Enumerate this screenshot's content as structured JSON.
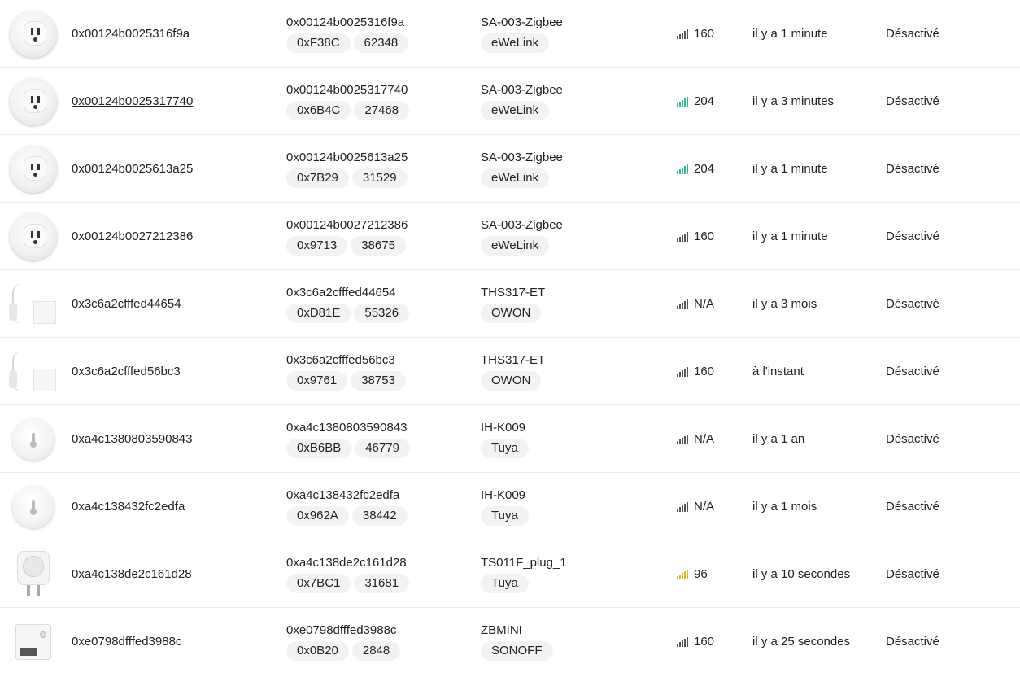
{
  "colors": {
    "signal_default": "#555555",
    "signal_good": "#2fbf8f",
    "signal_medium": "#e8b820"
  },
  "devices": [
    {
      "thumb": "round-plug-icon",
      "ieee": "0x00124b0025316f9a",
      "ieee_link": false,
      "ieee2": "0x00124b0025316f9a",
      "nwk": "0xF38C",
      "nwk_dec": "62348",
      "model": "SA-003-Zigbee",
      "vendor": "eWeLink",
      "lqi": "160",
      "signal_color": "#555555",
      "last_seen": "il y a 1 minute",
      "status": "Désactivé"
    },
    {
      "thumb": "round-plug-icon",
      "ieee": "0x00124b0025317740",
      "ieee_link": true,
      "ieee2": "0x00124b0025317740",
      "nwk": "0x6B4C",
      "nwk_dec": "27468",
      "model": "SA-003-Zigbee",
      "vendor": "eWeLink",
      "lqi": "204",
      "signal_color": "#2fbf8f",
      "last_seen": "il y a 3 minutes",
      "status": "Désactivé"
    },
    {
      "thumb": "round-plug-icon",
      "ieee": "0x00124b0025613a25",
      "ieee_link": false,
      "ieee2": "0x00124b0025613a25",
      "nwk": "0x7B29",
      "nwk_dec": "31529",
      "model": "SA-003-Zigbee",
      "vendor": "eWeLink",
      "lqi": "204",
      "signal_color": "#2fbf8f",
      "last_seen": "il y a 1 minute",
      "status": "Désactivé"
    },
    {
      "thumb": "round-plug-icon",
      "ieee": "0x00124b0027212386",
      "ieee_link": false,
      "ieee2": "0x00124b0027212386",
      "nwk": "0x9713",
      "nwk_dec": "38675",
      "model": "SA-003-Zigbee",
      "vendor": "eWeLink",
      "lqi": "160",
      "signal_color": "#555555",
      "last_seen": "il y a 1 minute",
      "status": "Désactivé"
    },
    {
      "thumb": "temp-probe-sensor-icon",
      "ieee": "0x3c6a2cfffed44654",
      "ieee_link": false,
      "ieee2": "0x3c6a2cfffed44654",
      "nwk": "0xD81E",
      "nwk_dec": "55326",
      "model": "THS317-ET",
      "vendor": "OWON",
      "lqi": "N/A",
      "signal_color": "#555555",
      "last_seen": "il y a 3 mois",
      "status": "Désactivé"
    },
    {
      "thumb": "temp-probe-sensor-icon",
      "ieee": "0x3c6a2cfffed56bc3",
      "ieee_link": false,
      "ieee2": "0x3c6a2cfffed56bc3",
      "nwk": "0x9761",
      "nwk_dec": "38753",
      "model": "THS317-ET",
      "vendor": "OWON",
      "lqi": "160",
      "signal_color": "#555555",
      "last_seen": "à l'instant",
      "status": "Désactivé"
    },
    {
      "thumb": "round-thermometer-icon",
      "ieee": "0xa4c1380803590843",
      "ieee_link": false,
      "ieee2": "0xa4c1380803590843",
      "nwk": "0xB6BB",
      "nwk_dec": "46779",
      "model": "IH-K009",
      "vendor": "Tuya",
      "lqi": "N/A",
      "signal_color": "#555555",
      "last_seen": "il y a 1 an",
      "status": "Désactivé"
    },
    {
      "thumb": "round-thermometer-icon",
      "ieee": "0xa4c138432fc2edfa",
      "ieee_link": false,
      "ieee2": "0xa4c138432fc2edfa",
      "nwk": "0x962A",
      "nwk_dec": "38442",
      "model": "IH-K009",
      "vendor": "Tuya",
      "lqi": "N/A",
      "signal_color": "#555555",
      "last_seen": "il y a 1 mois",
      "status": "Désactivé"
    },
    {
      "thumb": "eu-plug-icon",
      "ieee": "0xa4c138de2c161d28",
      "ieee_link": false,
      "ieee2": "0xa4c138de2c161d28",
      "nwk": "0x7BC1",
      "nwk_dec": "31681",
      "model": "TS011F_plug_1",
      "vendor": "Tuya",
      "lqi": "96",
      "signal_color": "#e8b820",
      "last_seen": "il y a 10 secondes",
      "status": "Désactivé"
    },
    {
      "thumb": "zbmini-switch-icon",
      "ieee": "0xe0798dfffed3988c",
      "ieee_link": false,
      "ieee2": "0xe0798dfffed3988c",
      "nwk": "0x0B20",
      "nwk_dec": "2848",
      "model": "ZBMINI",
      "vendor": "SONOFF",
      "lqi": "160",
      "signal_color": "#555555",
      "last_seen": "il y a 25 secondes",
      "status": "Désactivé"
    }
  ]
}
